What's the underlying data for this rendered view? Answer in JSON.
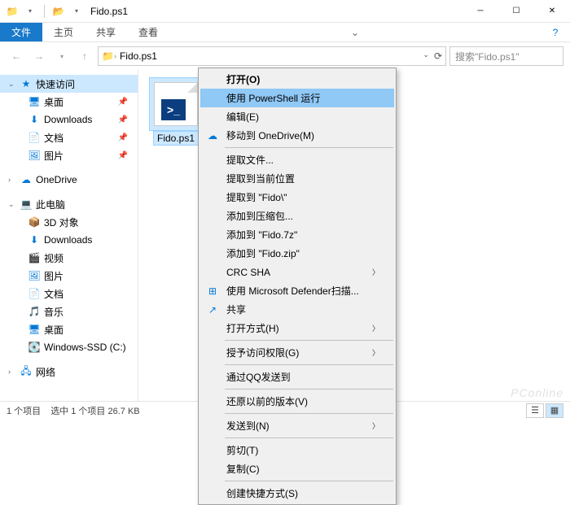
{
  "window": {
    "title": "Fido.ps1"
  },
  "ribbon": {
    "file": "文件",
    "home": "主页",
    "share": "共享",
    "view": "查看"
  },
  "address": {
    "crumb": "Fido.ps1",
    "search_placeholder": "搜索\"Fido.ps1\""
  },
  "sidebar": {
    "quick_access": "快速访问",
    "items_qa": [
      {
        "label": "桌面",
        "ico": "🖥",
        "pin": true
      },
      {
        "label": "Downloads",
        "ico": "⬇",
        "pin": true
      },
      {
        "label": "文档",
        "ico": "📄",
        "pin": true
      },
      {
        "label": "图片",
        "ico": "🖼",
        "pin": true
      }
    ],
    "onedrive": "OneDrive",
    "this_pc": "此电脑",
    "items_pc": [
      {
        "label": "3D 对象",
        "ico": "📦"
      },
      {
        "label": "Downloads",
        "ico": "⬇"
      },
      {
        "label": "视频",
        "ico": "🎬"
      },
      {
        "label": "图片",
        "ico": "🖼"
      },
      {
        "label": "文档",
        "ico": "📄"
      },
      {
        "label": "音乐",
        "ico": "🎵"
      },
      {
        "label": "桌面",
        "ico": "🖥"
      },
      {
        "label": "Windows-SSD (C:)",
        "ico": "💽"
      }
    ],
    "network": "网络"
  },
  "file": {
    "name": "Fido.ps1"
  },
  "context_menu": [
    {
      "label": "打开(O)",
      "type": "item"
    },
    {
      "label": "使用 PowerShell 运行",
      "type": "item",
      "hover": true
    },
    {
      "label": "编辑(E)",
      "type": "item"
    },
    {
      "label": "移动到 OneDrive(M)",
      "type": "item",
      "icon": "☁"
    },
    {
      "type": "sep"
    },
    {
      "label": "提取文件...",
      "type": "item"
    },
    {
      "label": "提取到当前位置",
      "type": "item"
    },
    {
      "label": "提取到 \"Fido\\\"",
      "type": "item"
    },
    {
      "label": "添加到压缩包...",
      "type": "item"
    },
    {
      "label": "添加到 \"Fido.7z\"",
      "type": "item"
    },
    {
      "label": "添加到 \"Fido.zip\"",
      "type": "item"
    },
    {
      "label": "CRC SHA",
      "type": "item",
      "submenu": true
    },
    {
      "label": "使用 Microsoft Defender扫描...",
      "type": "item",
      "icon": "⊞"
    },
    {
      "label": "共享",
      "type": "item",
      "icon": "↗"
    },
    {
      "label": "打开方式(H)",
      "type": "item",
      "submenu": true
    },
    {
      "type": "sep"
    },
    {
      "label": "授予访问权限(G)",
      "type": "item",
      "submenu": true
    },
    {
      "type": "sep"
    },
    {
      "label": "通过QQ发送到",
      "type": "item"
    },
    {
      "type": "sep"
    },
    {
      "label": "还原以前的版本(V)",
      "type": "item"
    },
    {
      "type": "sep"
    },
    {
      "label": "发送到(N)",
      "type": "item",
      "submenu": true
    },
    {
      "type": "sep"
    },
    {
      "label": "剪切(T)",
      "type": "item"
    },
    {
      "label": "复制(C)",
      "type": "item"
    },
    {
      "type": "sep"
    },
    {
      "label": "创建快捷方式(S)",
      "type": "item"
    }
  ],
  "status": {
    "count": "1 个项目",
    "selection": "选中 1 个项目 26.7 KB"
  },
  "watermark": "PConline"
}
